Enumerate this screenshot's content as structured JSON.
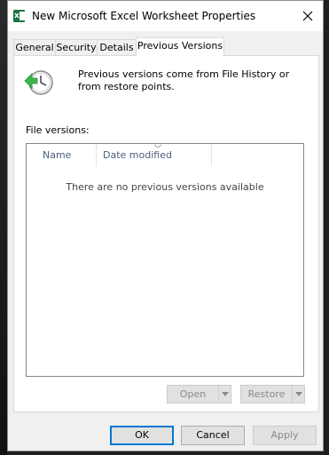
{
  "window": {
    "title": "New Microsoft Excel Worksheet Properties"
  },
  "tabs": [
    {
      "label": "General",
      "active": false
    },
    {
      "label": "Security",
      "active": false
    },
    {
      "label": "Details",
      "active": false
    },
    {
      "label": "Previous Versions",
      "active": true
    }
  ],
  "panel": {
    "info_text": "Previous versions come from File History or from restore points.",
    "file_versions_label": "File versions:",
    "columns": [
      "Name",
      "Date modified"
    ],
    "empty_message": "There are no previous versions available",
    "open_label": "Open",
    "restore_label": "Restore"
  },
  "footer": {
    "ok_label": "OK",
    "cancel_label": "Cancel",
    "apply_label": "Apply"
  },
  "icons": {
    "app": "excel-file-icon",
    "close": "close-icon",
    "history": "clock-history-icon"
  },
  "colors": {
    "accent": "#0078d7",
    "excel_green": "#1f7244",
    "disabled_text": "#8a8a8a"
  }
}
